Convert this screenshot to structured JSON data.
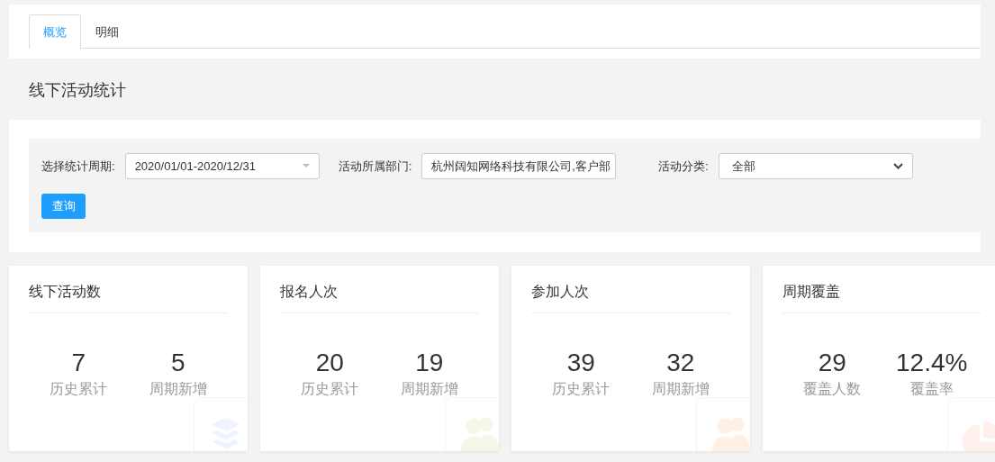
{
  "tabs": [
    {
      "label": "概览",
      "selected": true
    },
    {
      "label": "明细",
      "selected": false
    }
  ],
  "page_title": "线下活动统计",
  "filters": {
    "period": {
      "label": "选择统计周期:",
      "value": "2020/01/01-2020/12/31"
    },
    "department": {
      "label": "活动所属部门:",
      "value": "杭州阔知网络科技有限公司,客户部"
    },
    "category": {
      "label": "活动分类:",
      "value": "全部"
    },
    "query_button": "查询"
  },
  "cards": [
    {
      "title": "线下活动数",
      "kind": "layers",
      "color": "#eef4ff",
      "stats": [
        {
          "value": "7",
          "label": "历史累计"
        },
        {
          "value": "5",
          "label": "周期新增"
        }
      ]
    },
    {
      "title": "报名人次",
      "kind": "people",
      "color": "#f3f8e8",
      "stats": [
        {
          "value": "20",
          "label": "历史累计"
        },
        {
          "value": "19",
          "label": "周期新增"
        }
      ]
    },
    {
      "title": "参加人次",
      "kind": "people",
      "color": "#fff0e6",
      "stats": [
        {
          "value": "39",
          "label": "历史累计"
        },
        {
          "value": "32",
          "label": "周期新增"
        }
      ]
    },
    {
      "title": "周期覆盖",
      "kind": "pie",
      "color": "#fff0ec",
      "stats": [
        {
          "value": "29",
          "label": "覆盖人数"
        },
        {
          "value": "12.4%",
          "label": "覆盖率"
        }
      ]
    }
  ]
}
